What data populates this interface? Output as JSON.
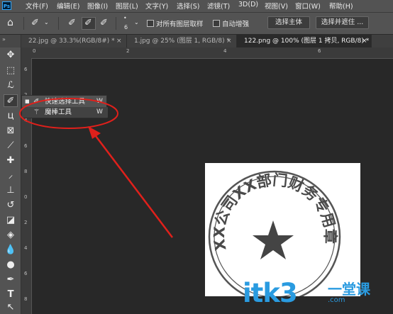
{
  "app": {
    "logo": "Ps"
  },
  "menu": [
    "文件(F)",
    "编辑(E)",
    "图像(I)",
    "图层(L)",
    "文字(Y)",
    "选择(S)",
    "滤镜(T)",
    "3D(D)",
    "视图(V)",
    "窗口(W)",
    "帮助(H)"
  ],
  "options": {
    "brush_size": "6",
    "sample_all_layers": "对所有图层取样",
    "auto_enhance": "自动增强",
    "select_subject": "选择主体",
    "select_and_mask": "选择并遮住 ..."
  },
  "tabs": [
    {
      "label": "22.jpg @ 33.3%(RGB/8#) *",
      "close": "×"
    },
    {
      "label": "1.jpg @ 25% (图层 1, RGB/8) *",
      "close": "×"
    },
    {
      "label": "122.png @ 100% (图层 1 拷贝, RGB/8) *",
      "close": "×"
    }
  ],
  "rulers": {
    "top": [
      "0",
      "2",
      "4",
      "6"
    ],
    "left": [
      "6",
      "2",
      "4",
      "6",
      "8",
      "0",
      "2",
      "4",
      "6",
      "8"
    ]
  },
  "flyout": [
    {
      "bullet": "■",
      "label": "快速选择工具",
      "key": "W"
    },
    {
      "bullet": "",
      "label": "魔棒工具",
      "key": "W"
    }
  ],
  "stamp": {
    "ring_text": "XX公司XX部门财务专用章"
  },
  "watermark": {
    "main": "itk3",
    "cn": "一堂课",
    "sub": ".com"
  },
  "colors": {
    "annotation": "#e0201b",
    "watermark": "#2a9be0",
    "ps_blue": "#31a8ff"
  }
}
